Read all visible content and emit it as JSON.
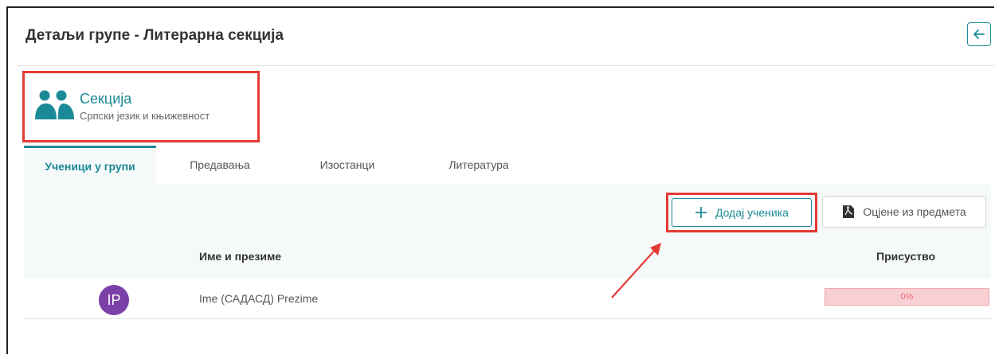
{
  "header": {
    "title": "Детаљи групе - Литерарна секција",
    "back_icon": "arrow-left-icon"
  },
  "section": {
    "name": "Секција",
    "subject": "Српски језик и књижевност",
    "icon": "group-users-icon"
  },
  "tabs": [
    {
      "label": "Ученици у групи",
      "active": true
    },
    {
      "label": "Предавања",
      "active": false
    },
    {
      "label": "Изостанци",
      "active": false
    },
    {
      "label": "Литература",
      "active": false
    }
  ],
  "toolbar": {
    "add_student_label": "Додај ученика",
    "add_icon": "plus-icon",
    "grades_label": "Оцјене из предмета",
    "grades_icon": "pdf-icon"
  },
  "table": {
    "columns": [
      "Име и презиме",
      "Присуство"
    ],
    "rows": [
      {
        "initials": "IP",
        "name": "Ime (САДАСД) Prezime",
        "attendance": "0%",
        "attendance_fraction": 0
      }
    ]
  },
  "colors": {
    "accent": "#1b8a96",
    "highlight": "#e53935",
    "avatar": "#7b3fa8",
    "attendance_bg": "#f8cfd2"
  }
}
